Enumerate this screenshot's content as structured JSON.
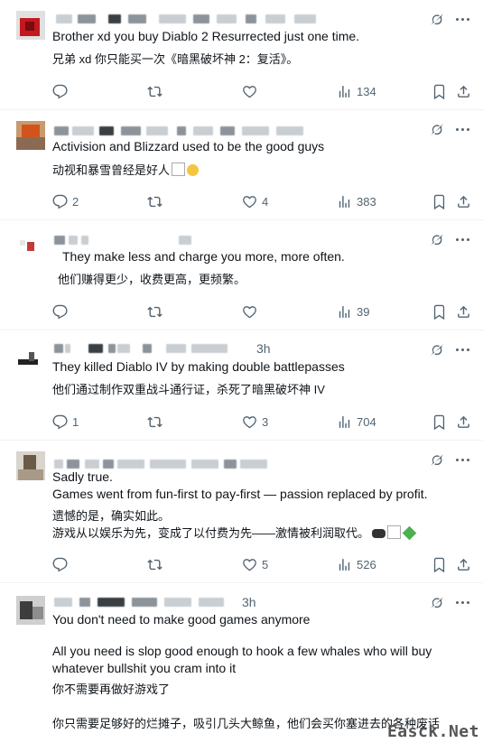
{
  "tweets": [
    {
      "time_fragment": "",
      "lines_en": [
        "Brother xd you buy Diablo 2 Resurrected just one time."
      ],
      "lines_zh": [
        "兄弟 xd 你只能买一次《暗黑破坏神 2：复活》。"
      ],
      "replies": "",
      "reposts": "",
      "likes": "",
      "views": "134"
    },
    {
      "time_fragment": "",
      "lines_en": [
        "Activision and Blizzard used to be the good guys"
      ],
      "lines_zh": [
        "动视和暴雪曾经是好人"
      ],
      "replies": "2",
      "reposts": "",
      "likes": "4",
      "views": "383"
    },
    {
      "time_fragment": "",
      "lines_en": [
        "They make less and charge you more, more often."
      ],
      "lines_zh": [
        "他们赚得更少，收费更高，更频繁。"
      ],
      "replies": "",
      "reposts": "",
      "likes": "",
      "views": "39"
    },
    {
      "time_fragment": "3h",
      "lines_en": [
        "They killed Diablo IV by making double battlepasses"
      ],
      "lines_zh": [
        "他们通过制作双重战斗通行证，杀死了暗黑破坏神 IV"
      ],
      "replies": "1",
      "reposts": "",
      "likes": "3",
      "views": "704"
    },
    {
      "time_fragment": "",
      "lines_en": [
        "Sadly true.",
        "Games went from fun-first to pay-first — passion replaced by profit."
      ],
      "lines_zh": [
        "遗憾的是，确实如此。",
        "游戏从以娱乐为先，变成了以付费为先——激情被利润取代。"
      ],
      "replies": "",
      "reposts": "",
      "likes": "5",
      "views": "526"
    },
    {
      "time_fragment": "3h",
      "lines_en": [
        "You don't need to make good games anymore",
        "All you need is slop good enough to hook a few whales who will buy",
        "whatever bullshit you cram into it"
      ],
      "lines_zh": [
        "你不需要再做好游戏了",
        "你只需要足够好的烂摊子，吸引几头大鲸鱼，他们会买你塞进去的各种废话"
      ]
    }
  ],
  "icons": [
    "grok-icon",
    "more-icon",
    "reply-icon",
    "repost-icon",
    "like-icon",
    "views-icon",
    "bookmark-icon",
    "share-icon"
  ],
  "watermark": "Easck.Net"
}
